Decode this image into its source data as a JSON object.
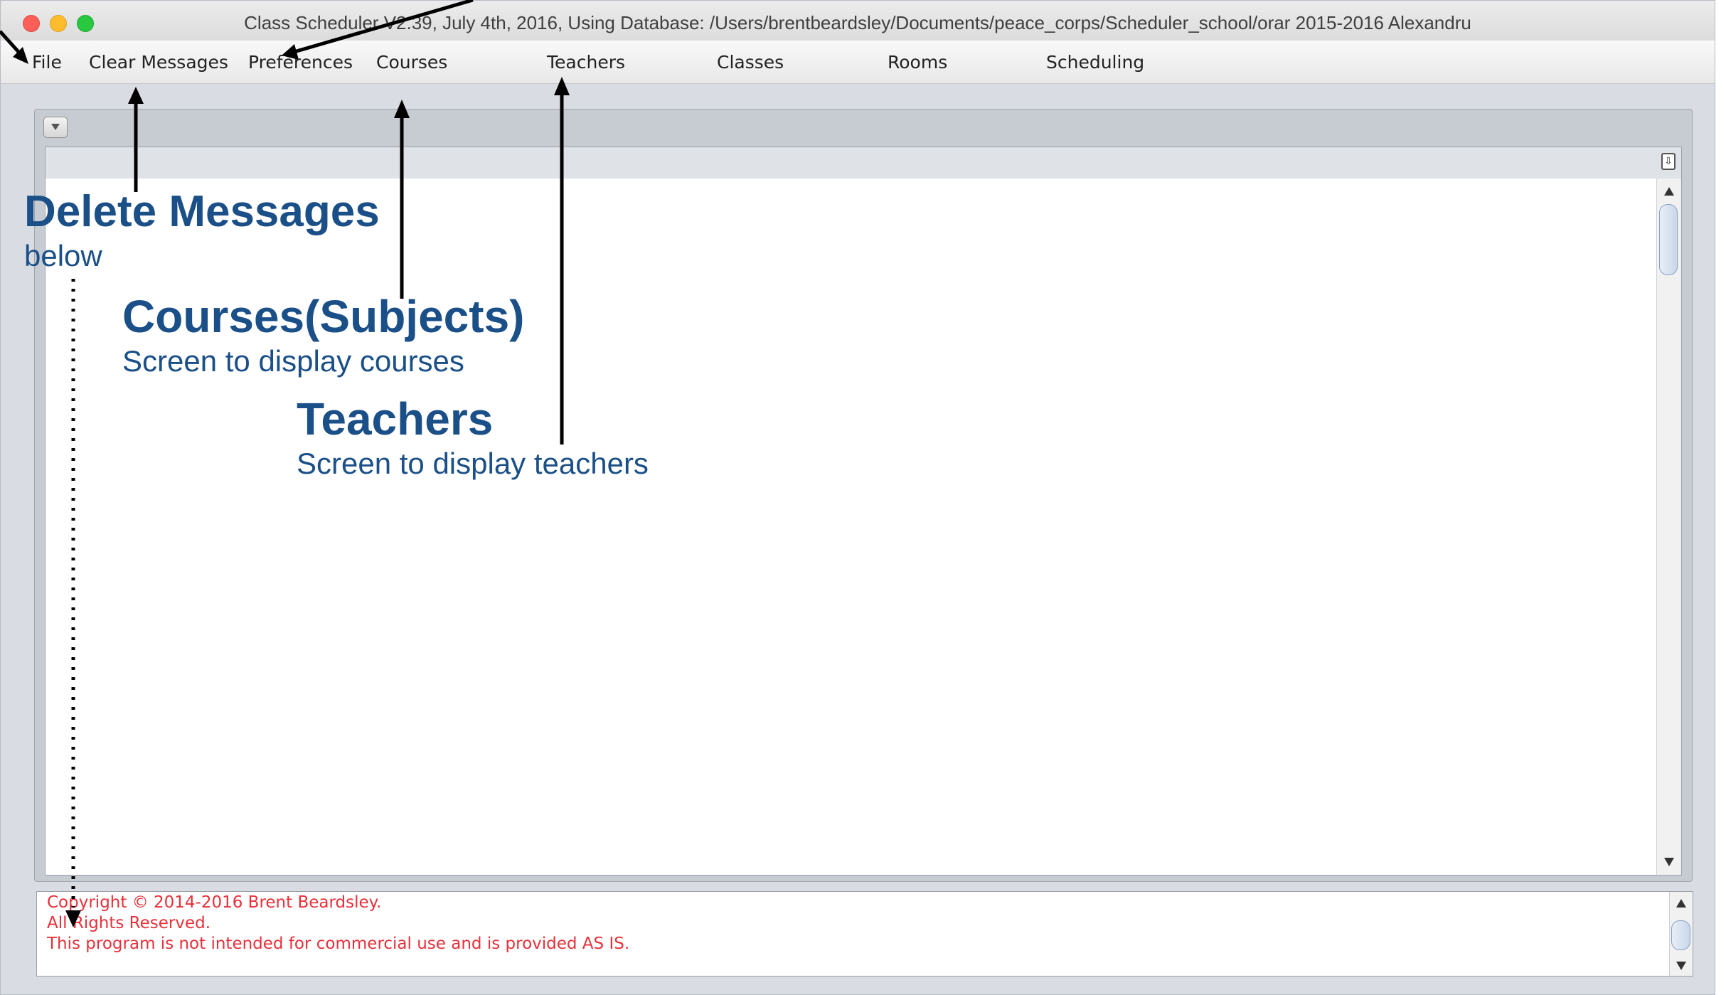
{
  "window": {
    "title": "Class Scheduler V2.39, July 4th, 2016, Using Database: /Users/brentbeardsley/Documents/peace_corps/Scheduler_school/orar 2015-2016 Alexandru"
  },
  "menu": {
    "file": "File",
    "clear_messages": "Clear Messages",
    "preferences": "Preferences",
    "courses": "Courses",
    "teachers": "Teachers",
    "classes": "Classes",
    "rooms": "Rooms",
    "scheduling": "Scheduling"
  },
  "annotations": {
    "delete_messages": {
      "title": "Delete Messages",
      "desc": "below"
    },
    "courses": {
      "title": "Courses(Subjects)",
      "desc": "Screen to display courses"
    },
    "teachers": {
      "title": "Teachers",
      "desc": "Screen to display teachers"
    }
  },
  "messages": {
    "lines": [
      "Copyright © 2014-2016 Brent Beardsley.",
      "All Rights Reserved.",
      "This program is not intended for commercial use and is provided AS IS."
    ]
  },
  "colors": {
    "annotation": "#1b4f88",
    "message_text": "#e8303a"
  },
  "icons": {
    "collapse": "chevron-down-icon",
    "corner": "panel-toggle-icon"
  }
}
